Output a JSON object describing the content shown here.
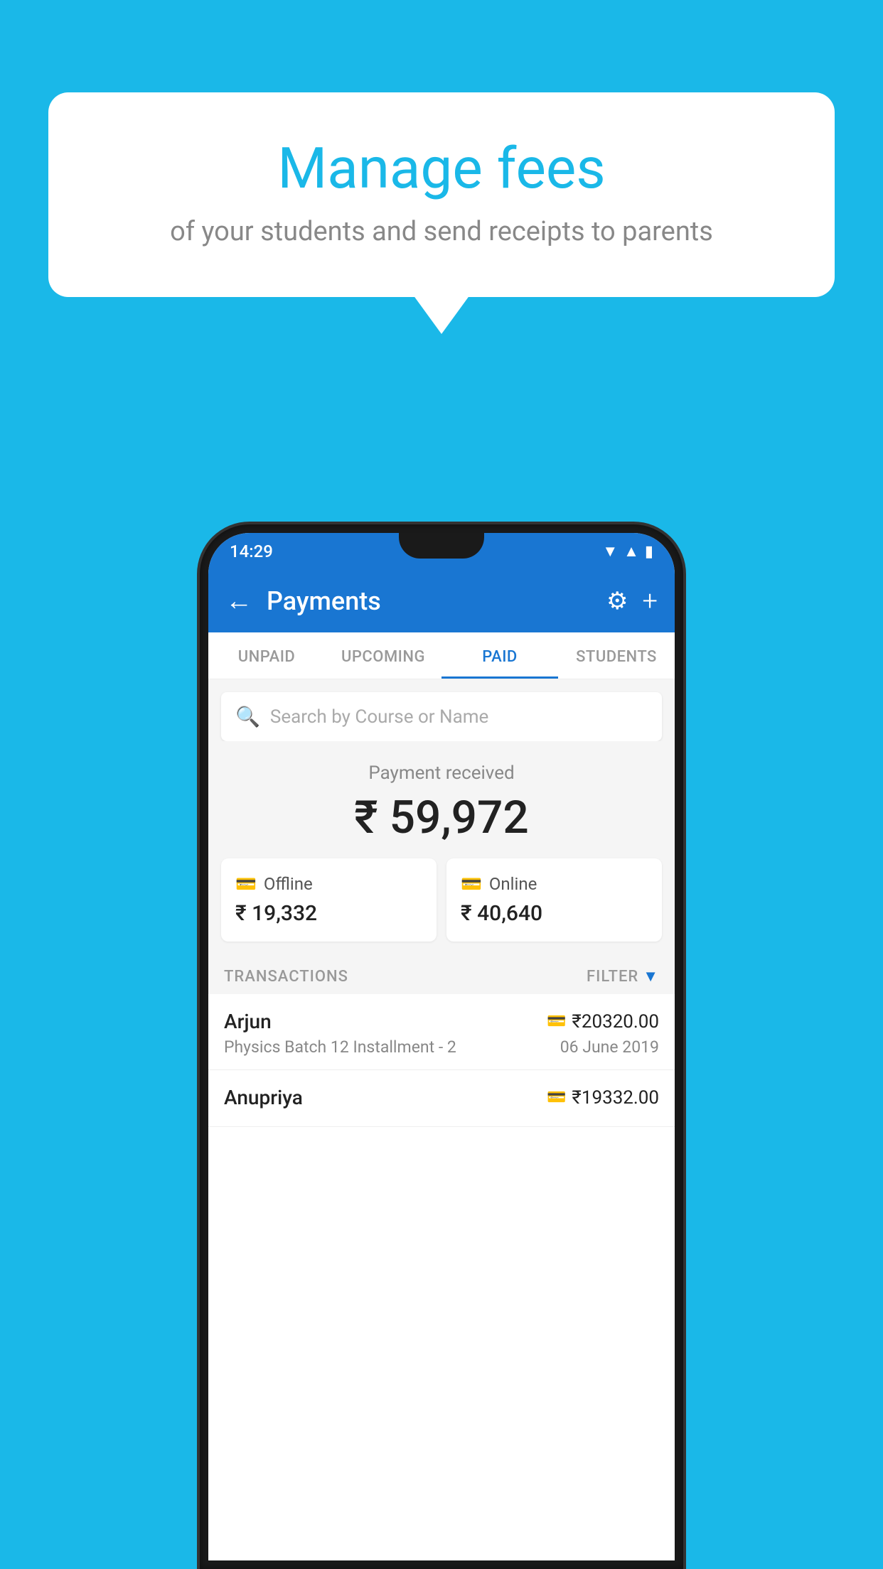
{
  "background_color": "#1ab8e8",
  "bubble": {
    "title": "Manage fees",
    "subtitle": "of your students and send receipts to parents"
  },
  "status_bar": {
    "time": "14:29",
    "wifi_icon": "▼",
    "signal_icon": "▲",
    "battery_icon": "▮"
  },
  "app_bar": {
    "title": "Payments",
    "back_icon": "←",
    "gear_icon": "⚙",
    "plus_icon": "+"
  },
  "tabs": [
    {
      "label": "UNPAID",
      "active": false
    },
    {
      "label": "UPCOMING",
      "active": false
    },
    {
      "label": "PAID",
      "active": true
    },
    {
      "label": "STUDENTS",
      "active": false
    }
  ],
  "search": {
    "placeholder": "Search by Course or Name",
    "icon": "🔍"
  },
  "payment_section": {
    "label": "Payment received",
    "amount": "₹ 59,972"
  },
  "payment_cards": [
    {
      "type": "Offline",
      "amount": "₹ 19,332",
      "icon": "💳"
    },
    {
      "type": "Online",
      "amount": "₹ 40,640",
      "icon": "🪙"
    }
  ],
  "transactions_section": {
    "label": "TRANSACTIONS",
    "filter_label": "FILTER"
  },
  "transactions": [
    {
      "name": "Arjun",
      "course": "Physics Batch 12 Installment - 2",
      "amount": "₹20320.00",
      "date": "06 June 2019",
      "type": "online"
    },
    {
      "name": "Anupriya",
      "course": "",
      "amount": "₹19332.00",
      "date": "",
      "type": "offline"
    }
  ]
}
